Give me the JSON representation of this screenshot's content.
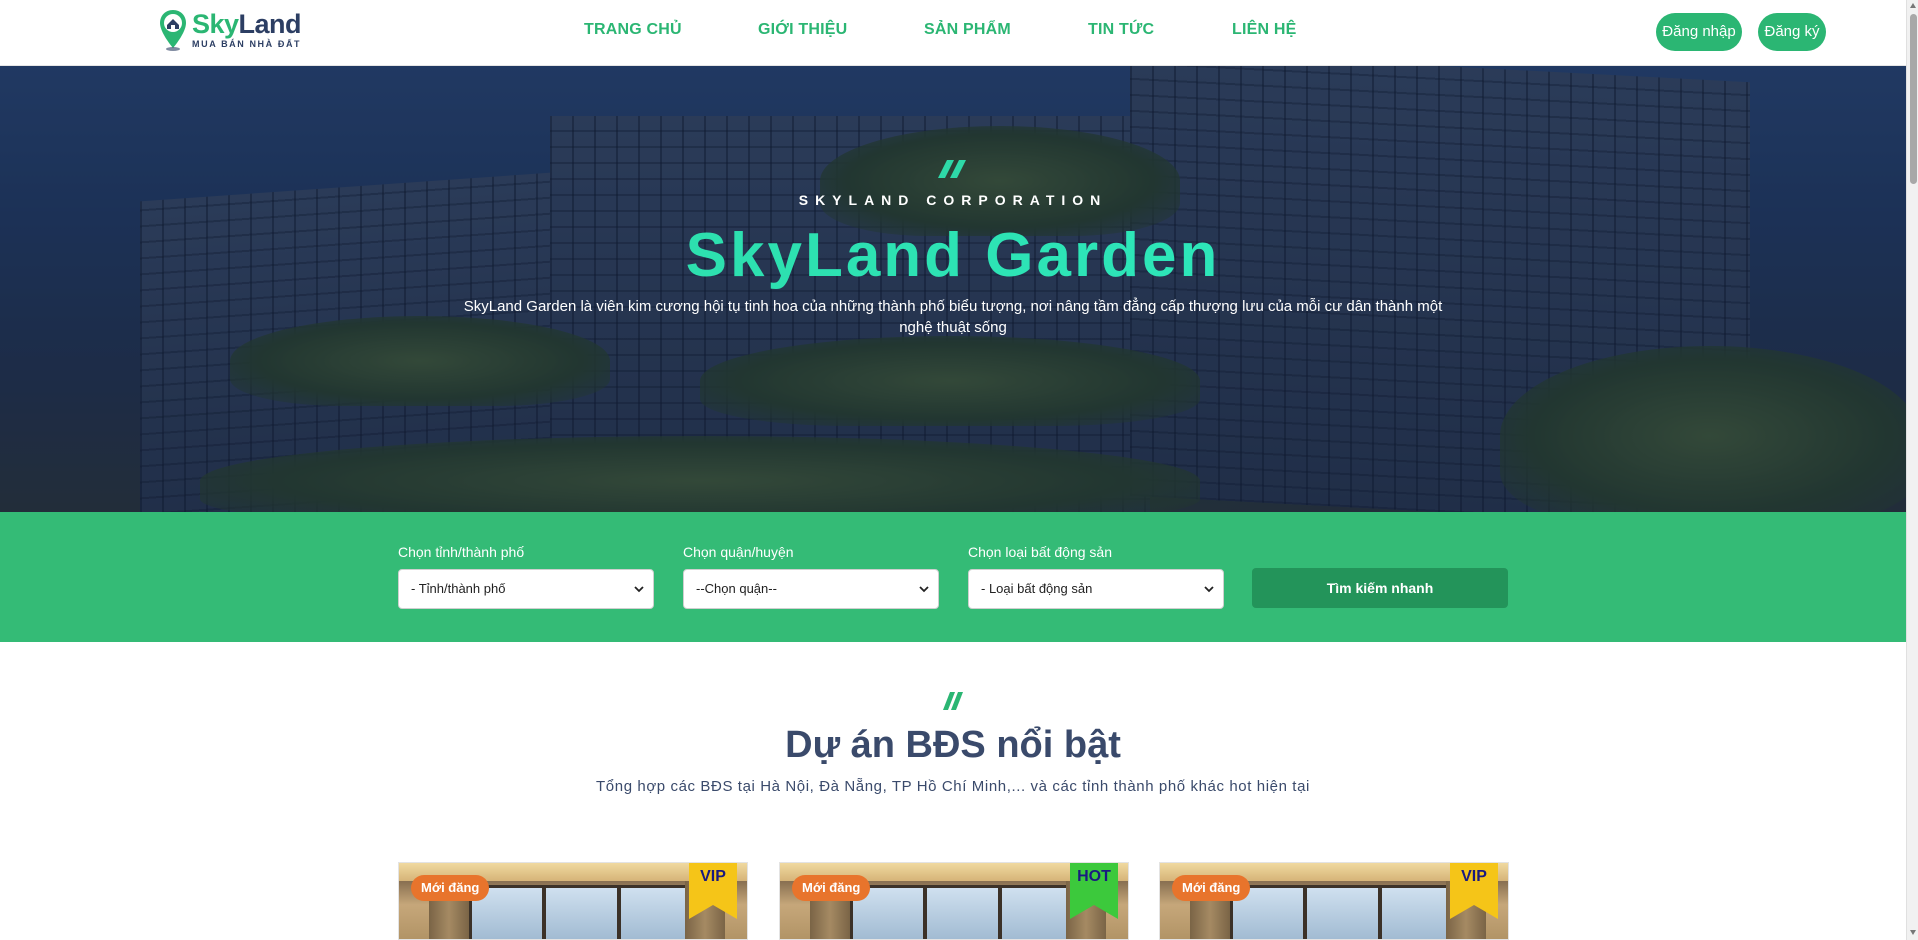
{
  "brand": {
    "name_part1": "Sky",
    "name_part2": "Land",
    "tagline": "MUA BÁN NHÀ ĐẤT",
    "accent_color": "#2bb673",
    "dark_color": "#2c3e63"
  },
  "nav": {
    "items": [
      "TRANG CHỦ",
      "GIỚI THIỆU",
      "SẢN PHẨM",
      "TIN TỨC",
      "LIÊN HỆ"
    ]
  },
  "auth": {
    "login_label": "Đăng nhập",
    "register_label": "Đăng ký"
  },
  "hero": {
    "subtitle": "SKYLAND CORPORATION",
    "title": "SkyLand Garden",
    "description": "SkyLand Garden là viên kim cương hội tụ tinh hoa của những thành phố biểu tượng, nơi nâng tầm đẳng cấp thượng lưu của mỗi cư dân thành một nghệ thuật sống"
  },
  "search": {
    "background": "#34bb76",
    "fields": [
      {
        "label": "Chọn tỉnh/thành phố",
        "selected": "- Tỉnh/thành phố"
      },
      {
        "label": "Chọn quận/huyện",
        "selected": "--Chọn quận--"
      },
      {
        "label": "Chọn loại bất động sản",
        "selected": "- Loại bất động sản"
      }
    ],
    "button_label": "Tìm kiếm nhanh"
  },
  "featured": {
    "title": "Dự án BĐS nổi bật",
    "description": "Tổng hợp các BĐS tại Hà Nội, Đà Nẵng, TP Hồ Chí Minh,... và các tỉnh thành phố khác hot hiện tại",
    "cards": [
      {
        "badge": "Mới đăng",
        "tag": "VIP",
        "tag_color": "#f5c518"
      },
      {
        "badge": "Mới đăng",
        "tag": "HOT",
        "tag_color": "#3cc93c"
      },
      {
        "badge": "Mới đăng",
        "tag": "VIP",
        "tag_color": "#f5c518"
      }
    ]
  },
  "icons": {
    "logo": "map-pin-house-icon",
    "hero_accent": "double-slash-icon",
    "select_arrow": "chevron-down-icon"
  }
}
